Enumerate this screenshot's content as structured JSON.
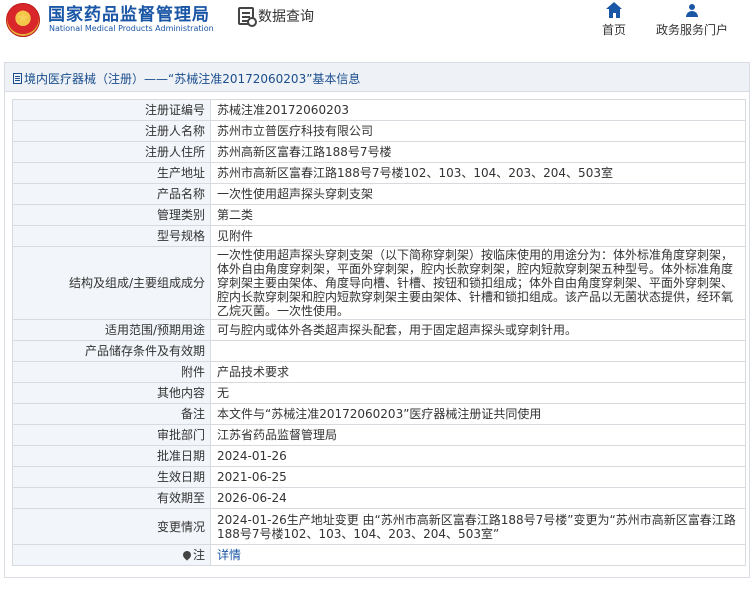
{
  "header": {
    "org_cn": "国家药品监督管理局",
    "org_en": "National Medical Products Administration",
    "page_title": "数据查询",
    "nav": [
      {
        "label": "首页",
        "icon": "home-icon"
      },
      {
        "label": "政务服务门户",
        "icon": "user-icon"
      }
    ],
    "brand_color": "#1a56a6"
  },
  "breadcrumb": "境内医疗器械（注册）——“苏械注准20172060203”基本信息",
  "rows": [
    {
      "label": "注册证编号",
      "value": "苏械注准20172060203"
    },
    {
      "label": "注册人名称",
      "value": "苏州市立普医疗科技有限公司"
    },
    {
      "label": "注册人住所",
      "value": "苏州高新区富春江路188号7号楼"
    },
    {
      "label": "生产地址",
      "value": "苏州市高新区富春江路188号7号楼102、103、104、203、204、503室"
    },
    {
      "label": "产品名称",
      "value": "一次性使用超声探头穿刺支架"
    },
    {
      "label": "管理类别",
      "value": "第二类"
    },
    {
      "label": "型号规格",
      "value": "见附件"
    },
    {
      "label": "结构及组成/主要组成成分",
      "value": "一次性使用超声探头穿刺支架（以下简称穿刺架）按临床使用的用途分为：体外标准角度穿刺架，体外自由角度穿刺架，平面外穿刺架，腔内长款穿刺架，腔内短款穿刺架五种型号。体外标准角度穿刺架主要由架体、角度导向槽、针槽、按钮和锁扣组成；体外自由角度穿刺架、平面外穿刺架、腔内长款穿刺架和腔内短款穿刺架主要由架体、针槽和锁扣组成。该产品以无菌状态提供，经环氧乙烷灭菌。一次性使用。"
    },
    {
      "label": "适用范围/预期用途",
      "value": "可与腔内或体外各类超声探头配套，用于固定超声探头或穿刺针用。"
    },
    {
      "label": "产品储存条件及有效期",
      "value": ""
    },
    {
      "label": "附件",
      "value": "产品技术要求"
    },
    {
      "label": "其他内容",
      "value": "无"
    },
    {
      "label": "备注",
      "value": "本文件与“苏械注准20172060203”医疗器械注册证共同使用"
    },
    {
      "label": "审批部门",
      "value": "江苏省药品监督管理局"
    },
    {
      "label": "批准日期",
      "value": "2024-01-26"
    },
    {
      "label": "生效日期",
      "value": "2021-06-25"
    },
    {
      "label": "有效期至",
      "value": "2026-06-24"
    },
    {
      "label": "变更情况",
      "value": "2024-01-26生产地址变更 由“苏州市高新区富春江路188号7号楼”变更为“苏州市高新区富春江路188号7号楼102、103、104、203、204、503室”"
    }
  ],
  "note_row": {
    "label": "注",
    "icon": "pin-icon",
    "link": "详情"
  }
}
